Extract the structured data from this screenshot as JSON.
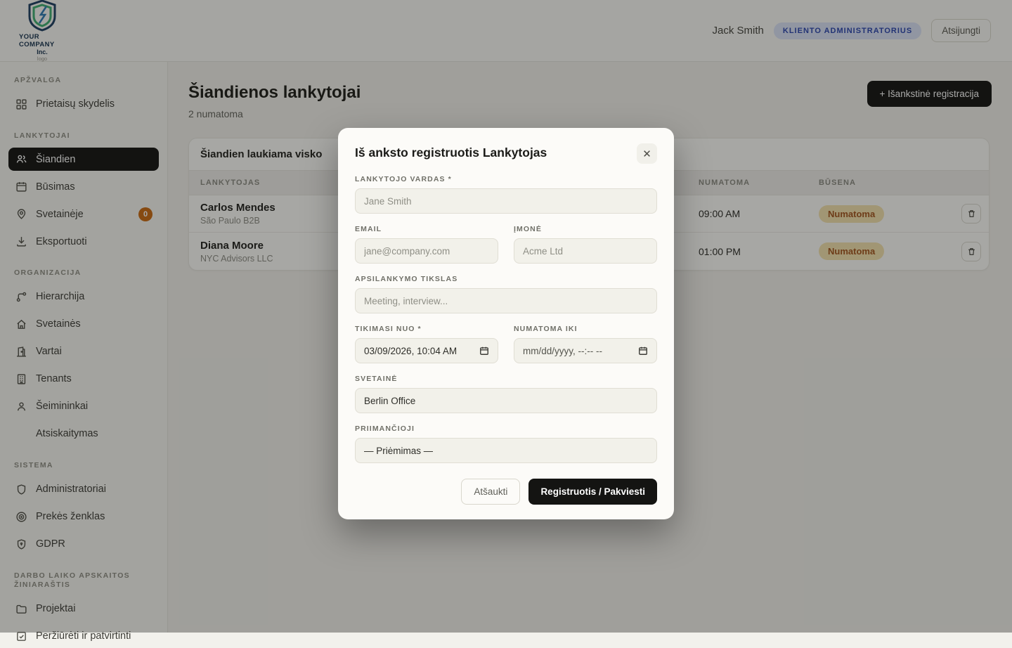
{
  "colors": {
    "accent_black": "#141412",
    "badge_orange": "#c96a12",
    "status_badge_bg": "#f4e3af",
    "status_badge_text": "#a4551e",
    "role_badge_bg": "#dbe3f7",
    "role_badge_text": "#2c47b0",
    "overlay": "rgba(18,18,16,0.37)"
  },
  "header": {
    "logo_company": "YOUR COMPANY",
    "logo_inc": "Inc.",
    "logo_caption": "logo",
    "user_name": "Jack Smith",
    "role_badge": "KLIENTO ADMINISTRATORIUS",
    "logout_label": "Atsijungti"
  },
  "sidebar": {
    "sections": [
      {
        "label": "APŽVALGA",
        "items": [
          {
            "label": "Prietaisų skydelis",
            "icon": "dashboard-icon"
          }
        ]
      },
      {
        "label": "LANKYTOJAI",
        "items": [
          {
            "label": "Šiandien",
            "icon": "people-icon",
            "active": true
          },
          {
            "label": "Būsimas",
            "icon": "calendar-icon"
          },
          {
            "label": "Svetainėje",
            "icon": "map-pin-icon",
            "badge": "0"
          },
          {
            "label": "Eksportuoti",
            "icon": "download-icon"
          }
        ]
      },
      {
        "label": "ORGANIZACIJA",
        "items": [
          {
            "label": "Hierarchija",
            "icon": "hierarchy-icon"
          },
          {
            "label": "Svetainės",
            "icon": "home-icon"
          },
          {
            "label": "Vartai",
            "icon": "gate-icon"
          },
          {
            "label": "Tenants",
            "icon": "building-icon"
          },
          {
            "label": "Šeimininkai",
            "icon": "person-icon"
          },
          {
            "label": "Atsiskaitymas",
            "icon": null
          }
        ]
      },
      {
        "label": "SISTEMA",
        "items": [
          {
            "label": "Administratoriai",
            "icon": "shield-icon"
          },
          {
            "label": "Prekės ženklas",
            "icon": "target-icon"
          },
          {
            "label": "GDPR",
            "icon": "shield-lock-icon"
          }
        ]
      },
      {
        "label": "DARBO LAIKO APSKAITOS ŽINIARAŠTIS",
        "items": [
          {
            "label": "Projektai",
            "icon": "folder-icon"
          },
          {
            "label": "Peržiūrėti ir patvirtinti",
            "icon": "check-square-icon"
          }
        ]
      }
    ]
  },
  "main": {
    "page_title": "Šiandienos lankytojai",
    "page_subtitle": "2 numatoma",
    "preregister_button": "+ Išankstinė registracija",
    "card_title": "Šiandien laukiama visko",
    "table": {
      "columns": [
        "LANKYTOJAS",
        "NUMATOMA",
        "BŪSENA"
      ],
      "rows": [
        {
          "name": "Carlos Mendes",
          "company": "São Paulo B2B",
          "time": "09:00 AM",
          "status": "Numatoma"
        },
        {
          "name": "Diana Moore",
          "company": "NYC Advisors LLC",
          "time": "01:00 PM",
          "status": "Numatoma"
        }
      ]
    }
  },
  "modal": {
    "title": "Iš anksto registruotis Lankytojas",
    "close_icon": "✕",
    "fields": {
      "visitor_name": {
        "label": "LANKYTOJO VARDAS *",
        "placeholder": "Jane Smith"
      },
      "email": {
        "label": "EMAIL",
        "placeholder": "jane@company.com"
      },
      "company": {
        "label": "ĮMONĖ",
        "placeholder": "Acme Ltd"
      },
      "purpose": {
        "label": "APSILANKYMO TIKSLAS",
        "placeholder": "Meeting, interview..."
      },
      "expected_from": {
        "label": "TIKIMASI NUO *",
        "value": "03/09/2026, 10:04 AM"
      },
      "expected_until": {
        "label": "NUMATOMA IKI",
        "value": "mm/dd/yyyy, --:-- --"
      },
      "site": {
        "label": "SVETAINĖ",
        "value": "Berlin Office"
      },
      "host": {
        "label": "PRIIMANČIOJI",
        "value": "— Priėmimas —"
      }
    },
    "cancel_label": "Atšaukti",
    "submit_label": "Registruotis / Pakviesti"
  }
}
